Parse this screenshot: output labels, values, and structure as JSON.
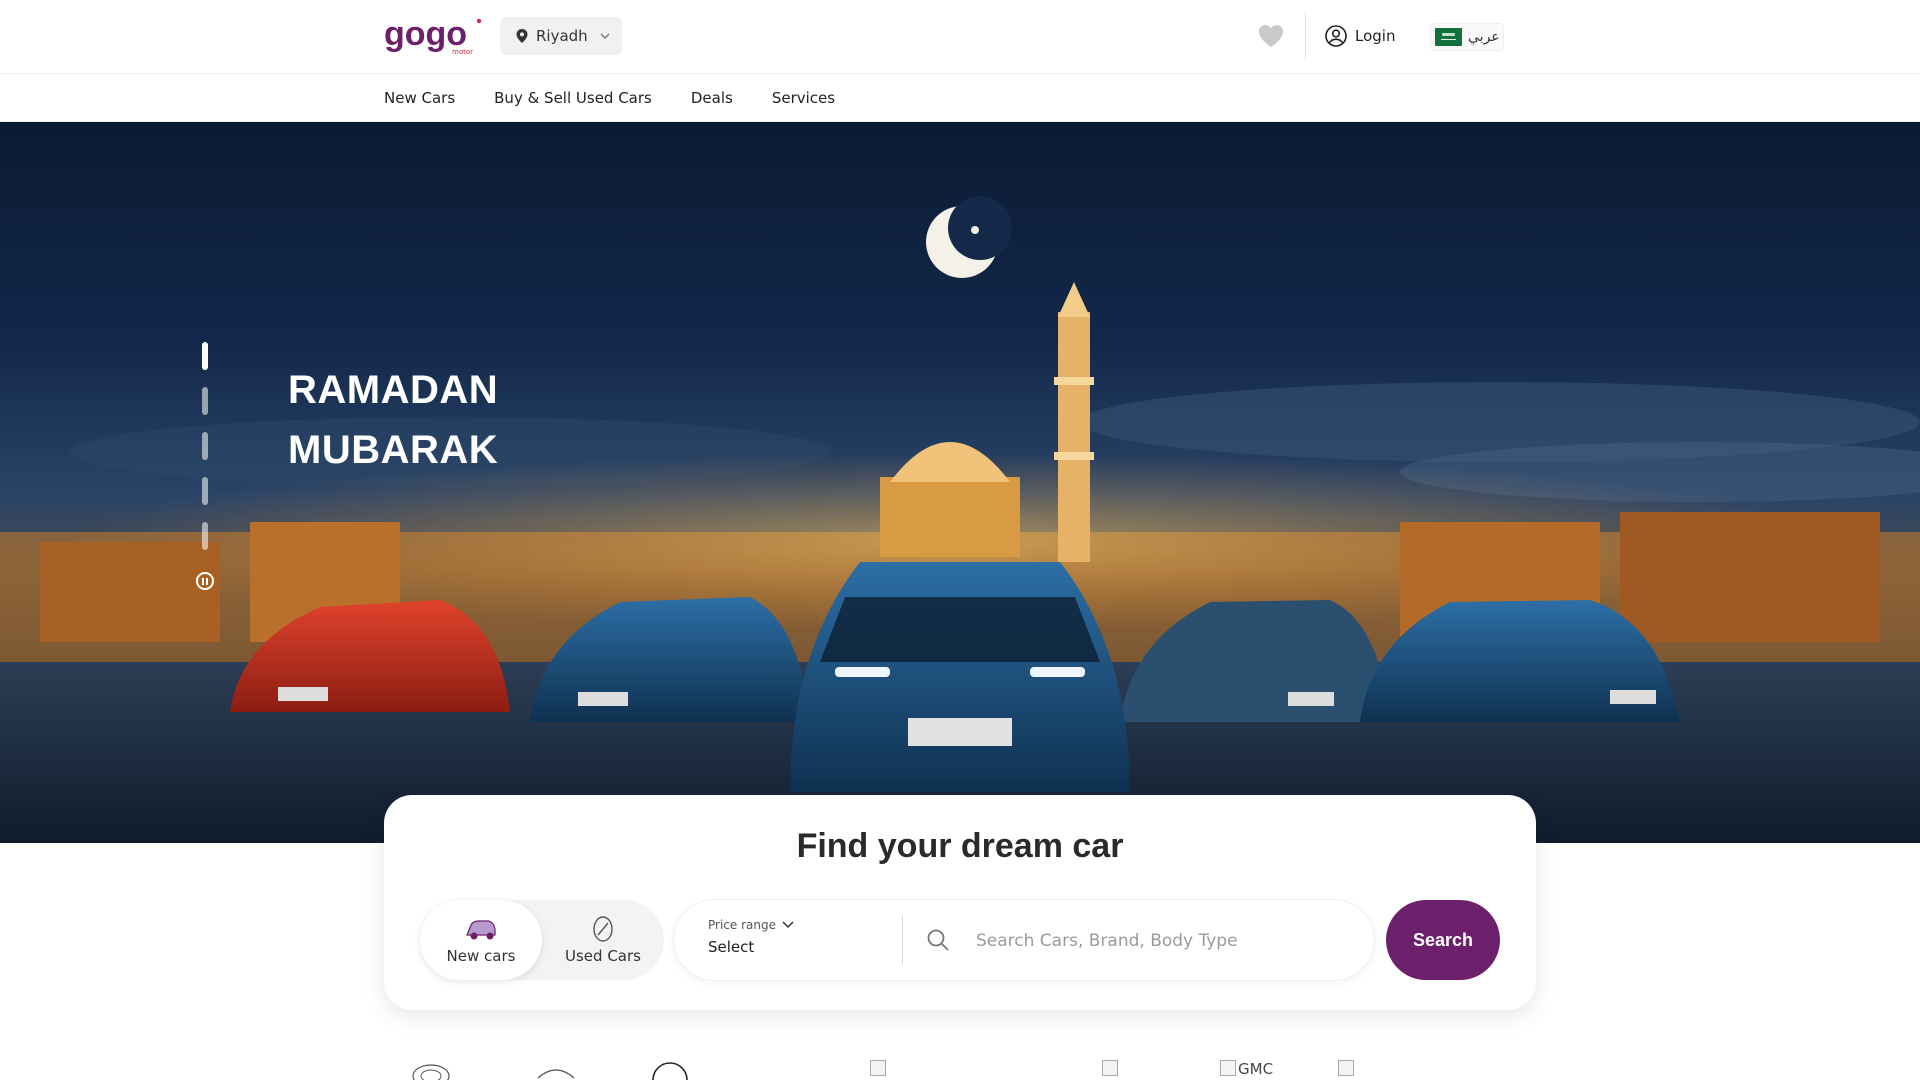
{
  "header": {
    "logo_text": "gogo",
    "logo_sub": "motor",
    "location": "Riyadh",
    "login_label": "Login",
    "language_label": "عربي"
  },
  "nav": {
    "items": [
      "New Cars",
      "Buy & Sell Used Cars",
      "Deals",
      "Services"
    ]
  },
  "hero": {
    "title_line1": "RAMADAN",
    "title_line2": "MUBARAK",
    "slides_count": 5,
    "active_slide": 1
  },
  "search_card": {
    "title": "Find your dream car",
    "toggle": {
      "new_label": "New cars",
      "used_label": "Used Cars",
      "selected": "New cars"
    },
    "price_range_label": "Price range",
    "price_range_value": "Select",
    "search_placeholder": "Search Cars, Brand, Body Type",
    "search_button": "Search"
  },
  "brands": {
    "gmc_alt": "GMC"
  },
  "colors": {
    "brand_purple": "#6c1f6a",
    "logo_red": "#d72a4a",
    "active_toggle_bg": "#ffffff"
  },
  "icons": [
    "location-pin-icon",
    "chevron-down-icon",
    "heart-icon",
    "user-circle-icon",
    "saudi-flag-icon",
    "pause-icon",
    "new-car-icon",
    "used-car-icon",
    "search-icon"
  ]
}
